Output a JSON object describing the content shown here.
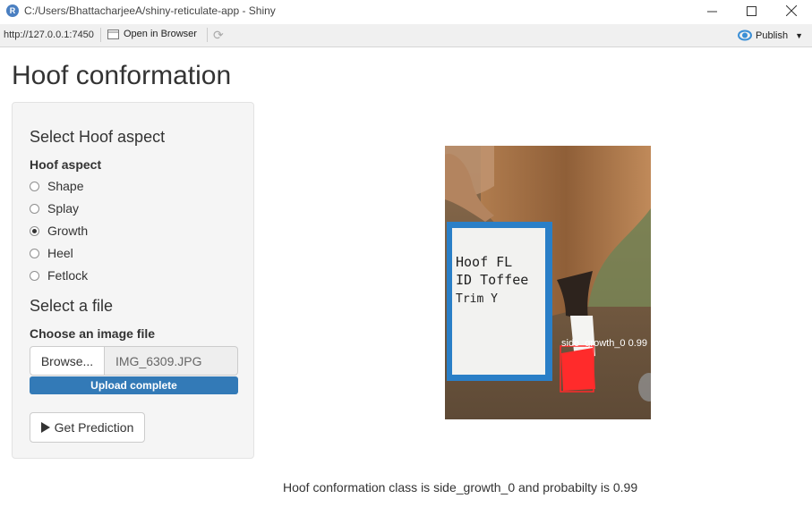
{
  "window": {
    "title": "C:/Users/BhattacharjeeA/shiny-reticulate-app - Shiny",
    "app_icon_letter": "R"
  },
  "toolbar": {
    "url": "http://127.0.0.1:7450",
    "open_in_browser": "Open in Browser",
    "publish": "Publish"
  },
  "page": {
    "title": "Hoof conformation"
  },
  "sidebar": {
    "aspect_heading": "Select Hoof aspect",
    "aspect_label": "Hoof aspect",
    "options": [
      {
        "label": "Shape",
        "checked": false
      },
      {
        "label": "Splay",
        "checked": false
      },
      {
        "label": "Growth",
        "checked": true
      },
      {
        "label": "Heel",
        "checked": false
      },
      {
        "label": "Fetlock",
        "checked": false
      }
    ],
    "file_heading": "Select a file",
    "file_label": "Choose an image file",
    "browse_label": "Browse...",
    "file_name": "IMG_6309.JPG",
    "upload_status": "Upload complete",
    "predict_label": "Get Prediction"
  },
  "image": {
    "board_lines": [
      "Hoof FL",
      "ID Toffee",
      "Trim  Y"
    ],
    "detection_label": "side_growth_0 0.99",
    "detection_color": "#ff2b2b"
  },
  "result": {
    "text": "Hoof conformation class is side_growth_0 and probabilty is 0.99"
  }
}
